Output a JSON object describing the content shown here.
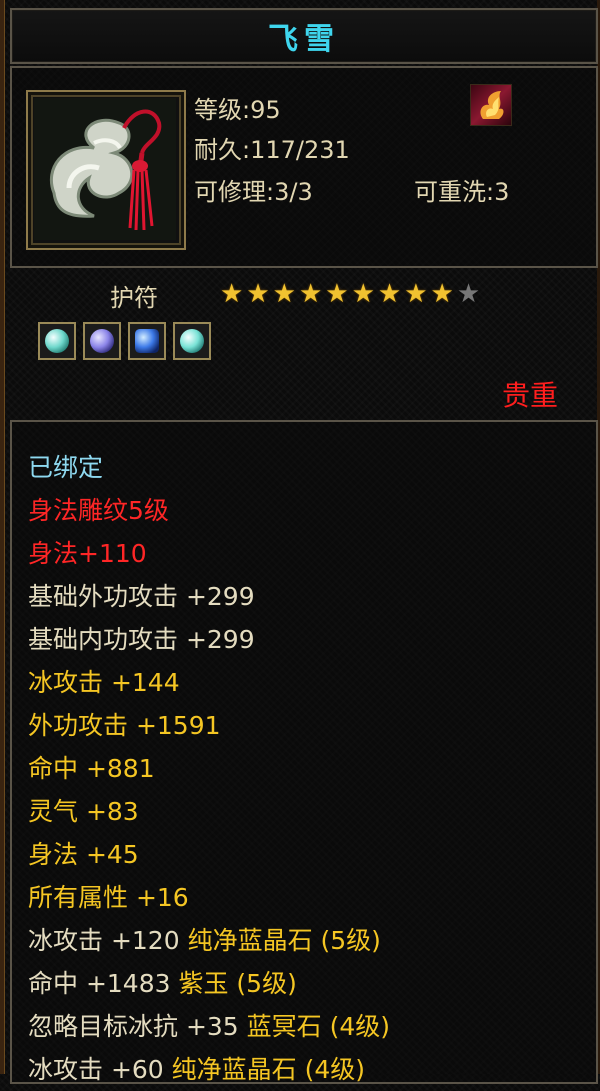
{
  "item": {
    "name": "飞雪",
    "type": "护符",
    "rarity": "贵重",
    "stars_filled": 9,
    "stars_total": 10
  },
  "stats": {
    "level": "等级:95",
    "durability": "耐久:117/231",
    "repair": "可修理:3/3",
    "rewash": "可重洗:3"
  },
  "gems": [
    "gem-cyan-icon",
    "gem-violet-icon",
    "gem-blue-icon",
    "gem-cyan-icon"
  ],
  "attributes": {
    "bound": "已绑定",
    "engrave": "身法雕纹5级",
    "engrave_bonus": "身法+110",
    "base_ext_attack": "基础外功攻击 +299",
    "base_int_attack": "基础内功攻击 +299",
    "ice_attack": "冰攻击 +144",
    "ext_attack": "外功攻击 +1591",
    "hit": "命中 +881",
    "spirit": "灵气 +83",
    "agility": "身法 +45",
    "all_attr": "所有属性 +16",
    "gem1_text": "冰攻击 +120",
    "gem1_name": "纯净蓝晶石 (5级)",
    "gem2_text": "命中 +1483",
    "gem2_name": "紫玉 (5级)",
    "gem3_text": "忽略目标冰抗 +35",
    "gem3_name": "蓝冥石 (4级)",
    "gem4_text": "冰攻击 +60",
    "gem4_name": "纯净蓝晶石 (4级)"
  },
  "colors": {
    "title": "#3fd6ee",
    "bound": "#8ed9f0",
    "red": "#ff2626",
    "yellow": "#f5c623",
    "white": "#e4dcc0",
    "rarity": "#ff1e1e"
  }
}
